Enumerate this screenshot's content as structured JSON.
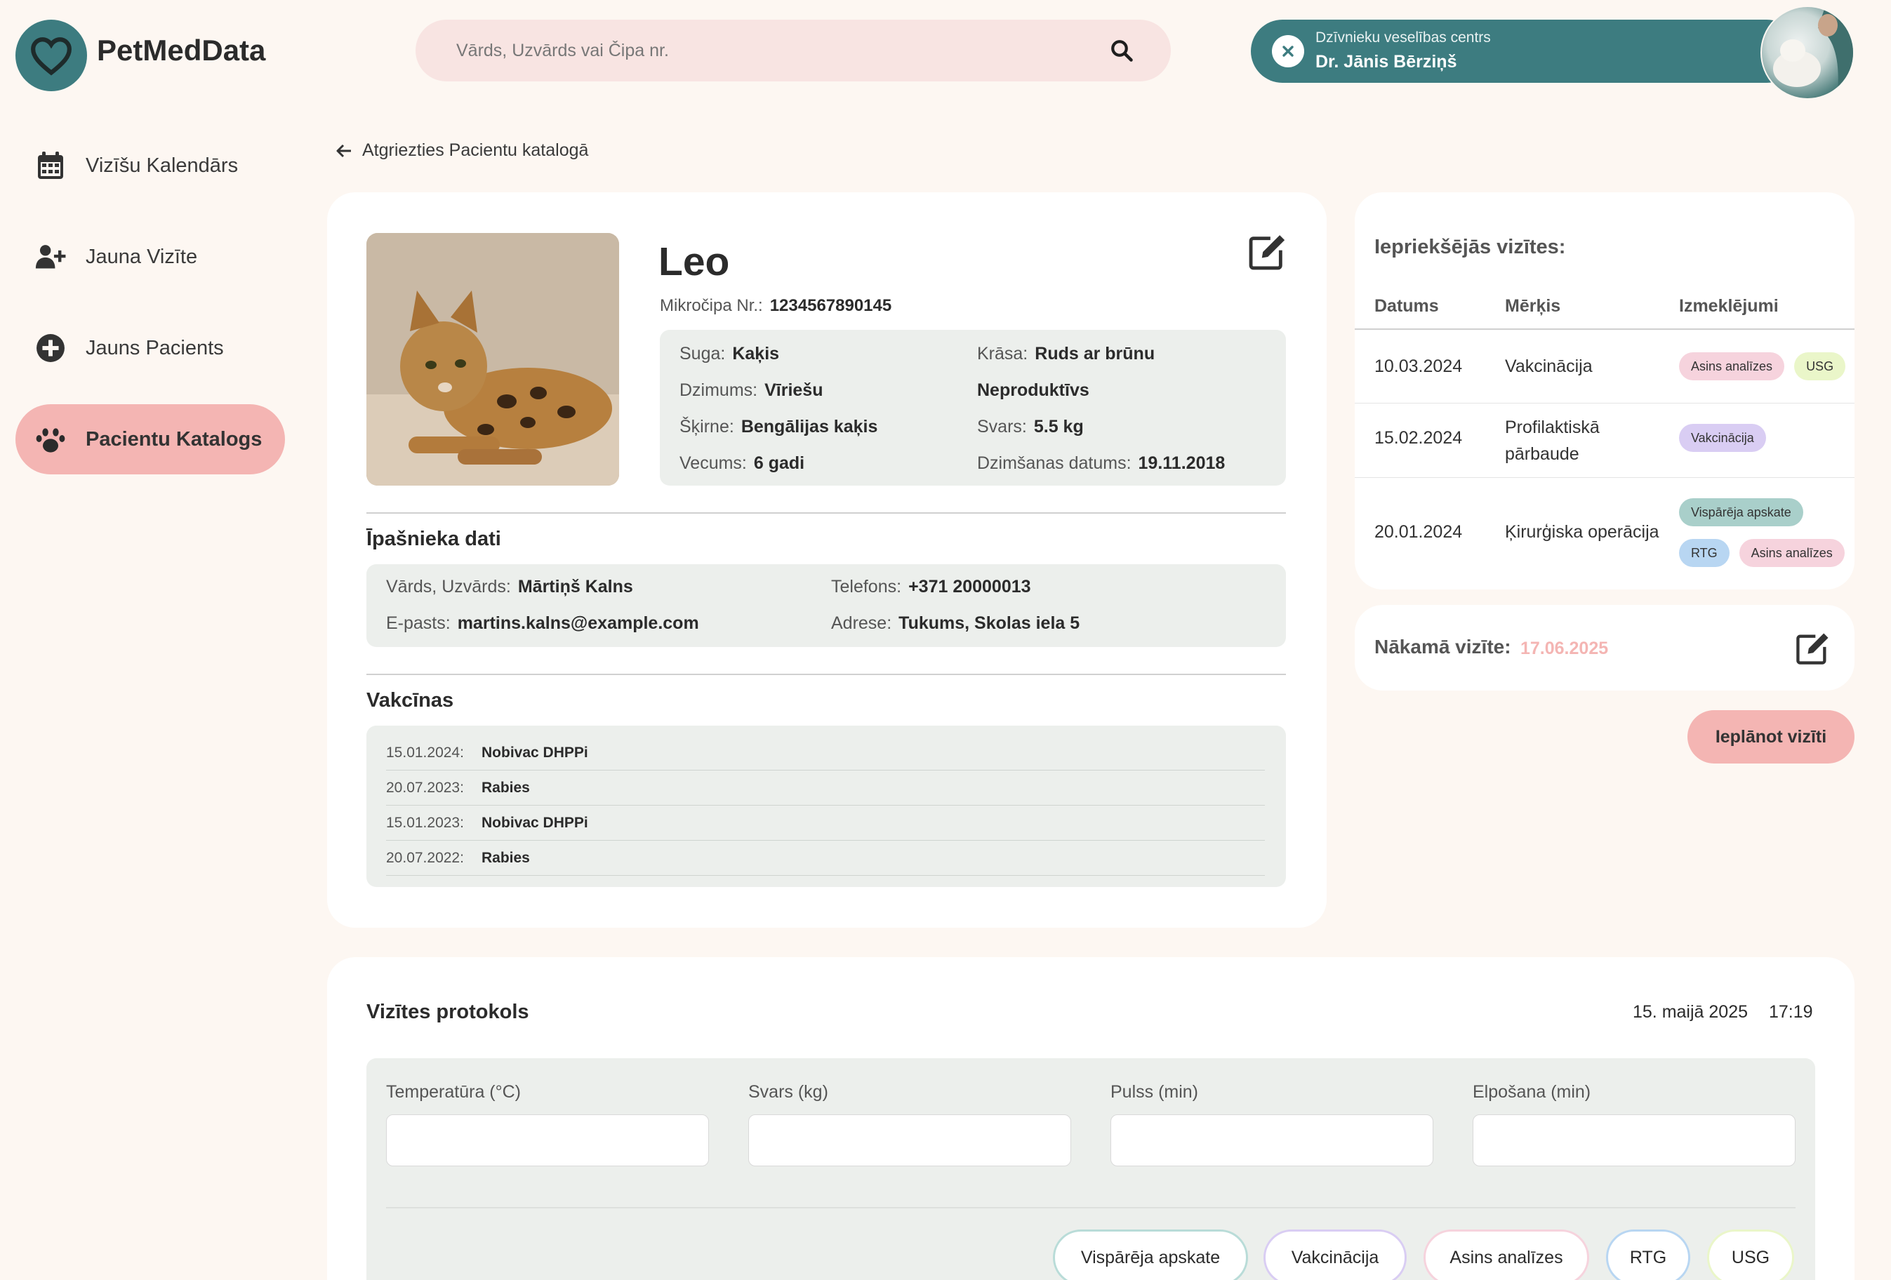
{
  "app": {
    "name": "PetMedData"
  },
  "search": {
    "placeholder": "Vārds, Uzvārds vai Čipa nr."
  },
  "doctor": {
    "organization": "Dzīvnieku veselības centrs",
    "name": "Dr. Jānis Bērziņš"
  },
  "sidebar": {
    "items": [
      {
        "label": "Vizīšu Kalendārs",
        "icon": "calendar-icon",
        "active": false
      },
      {
        "label": "Jauna Vizīte",
        "icon": "user-plus-icon",
        "active": false
      },
      {
        "label": "Jauns Pacients",
        "icon": "plus-circle-icon",
        "active": false
      },
      {
        "label": "Pacientu Katalogs",
        "icon": "paw-icon",
        "active": true
      }
    ]
  },
  "back_link": "Atgriezties Pacientu katalogā",
  "patient": {
    "name": "Leo",
    "chip_label": "Mikročipa Nr.:",
    "chip_value": "1234567890145",
    "species_label": "Suga:",
    "species": "Kaķis",
    "color_label": "Krāsa:",
    "color": "Ruds ar brūnu",
    "sex_label": "Dzimums:",
    "sex": "Vīriešu",
    "reproductive": "Neproduktīvs",
    "breed_label": "Šķirne:",
    "breed": "Bengālijas kaķis",
    "weight_label": "Svars:",
    "weight": "5.5 kg",
    "age_label": "Vecums:",
    "age": "6 gadi",
    "birth_label": "Dzimšanas datums:",
    "birth": "19.11.2018"
  },
  "owner": {
    "title": "Īpašnieka dati",
    "name_label": "Vārds, Uzvārds:",
    "name": "Mārtiņš Kalns",
    "phone_label": "Telefons:",
    "phone": "+371 20000013",
    "email_label": "E-pasts:",
    "email": "martins.kalns@example.com",
    "address_label": "Adrese:",
    "address": "Tukums, Skolas iela 5"
  },
  "vaccines": {
    "title": "Vakcīnas",
    "items": [
      {
        "date": "15.01.2024:",
        "name": "Nobivac DHPPi"
      },
      {
        "date": "20.07.2023:",
        "name": "Rabies"
      },
      {
        "date": "15.01.2023:",
        "name": "Nobivac DHPPi"
      },
      {
        "date": "20.07.2022:",
        "name": "Rabies"
      }
    ]
  },
  "previous_visits": {
    "title": "Iepriekšējās vizītes:",
    "headers": [
      "Datums",
      "Mērķis",
      "Izmeklējumi"
    ],
    "rows": [
      {
        "date": "10.03.2024",
        "purpose": "Vakcinācija",
        "tests": [
          "Asins analīzes",
          "USG"
        ]
      },
      {
        "date": "15.02.2024",
        "purpose": "Profilaktiskā pārbaude",
        "tests": [
          "Vakcinācija"
        ]
      },
      {
        "date": "20.01.2024",
        "purpose": "Ķirurģiska operācija",
        "tests": [
          "Vispārēja apskate",
          "RTG",
          "Asins analīzes"
        ]
      }
    ]
  },
  "next_visit": {
    "label": "Nākamā vizīte:",
    "date": "17.06.2025"
  },
  "plan_button": "Ieplānot vizīti",
  "protocol": {
    "title": "Vizītes protokols",
    "date": "15. maijā 2025",
    "time": "17:19",
    "fields": [
      "Temperatūra (°C)",
      "Svars (kg)",
      "Pulss (min)",
      "Elpošana (min)"
    ],
    "exam_types": [
      "Vispārēja apskate",
      "Vakcinācija",
      "Asins analīzes",
      "RTG",
      "USG"
    ]
  },
  "colors": {
    "primary": "#3d7c80",
    "accent_pink": "#f4b5b3",
    "tag_pink": "#f6d3dd",
    "tag_green": "#eaf6c9",
    "tag_purple": "#d9cdf3",
    "tag_teal": "#a9cfca",
    "tag_blue": "#b8d6f2"
  }
}
